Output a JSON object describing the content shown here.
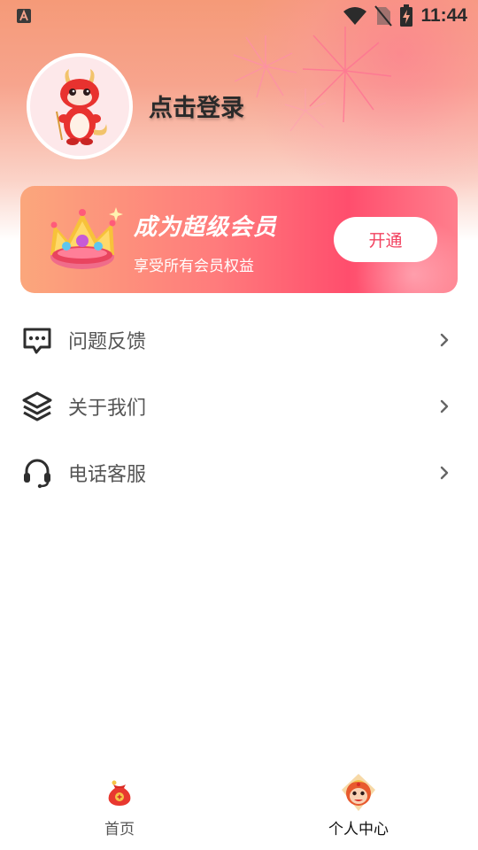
{
  "status_bar": {
    "time": "11:44",
    "left_icon": "a-notification-icon",
    "icons": [
      "wifi-icon",
      "no-sim-icon",
      "battery-charging-icon"
    ]
  },
  "profile": {
    "login_label": "点击登录",
    "avatar_icon": "dragon-mascot-icon"
  },
  "vip_card": {
    "title": "成为超级会员",
    "subtitle": "享受所有会员权益",
    "button_label": "开通",
    "icon": "crown-icon",
    "accent_color": "#f2425f"
  },
  "menu": {
    "items": [
      {
        "label": "问题反馈",
        "icon": "message-dots-icon"
      },
      {
        "label": "关于我们",
        "icon": "layers-icon"
      },
      {
        "label": "电话客服",
        "icon": "headset-icon"
      }
    ]
  },
  "bottom_nav": {
    "items": [
      {
        "label": "首页",
        "icon": "lucky-bag-icon",
        "active": false
      },
      {
        "label": "个人中心",
        "icon": "monkey-face-icon",
        "active": true
      }
    ]
  }
}
